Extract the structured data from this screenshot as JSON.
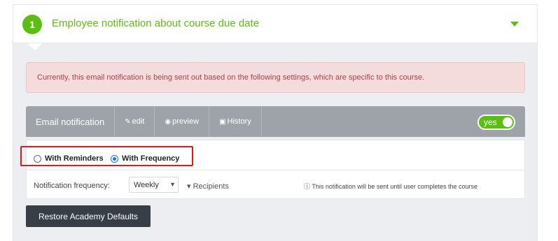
{
  "section": {
    "step_number": "1",
    "title": "Employee notification about course due date"
  },
  "alert": {
    "text": "Currently, this email notification is being sent out based on the following settings, which are specific to this course."
  },
  "tabs": {
    "title": "Email notification",
    "edit": "edit",
    "preview": "preview",
    "history": "History",
    "toggle_label": "yes"
  },
  "mode": {
    "reminders_label": "With Reminders",
    "frequency_label": "With Frequency",
    "selected": "With Frequency"
  },
  "frequency": {
    "label": "Notification frequency:",
    "selected": "Weekly",
    "recipients_label": "Recipients",
    "note": "This notification will be sent until user completes the course"
  },
  "actions": {
    "restore_label": "Restore Academy Defaults"
  },
  "colors": {
    "accent": "#5bbf12",
    "highlight_border": "#e01818"
  }
}
